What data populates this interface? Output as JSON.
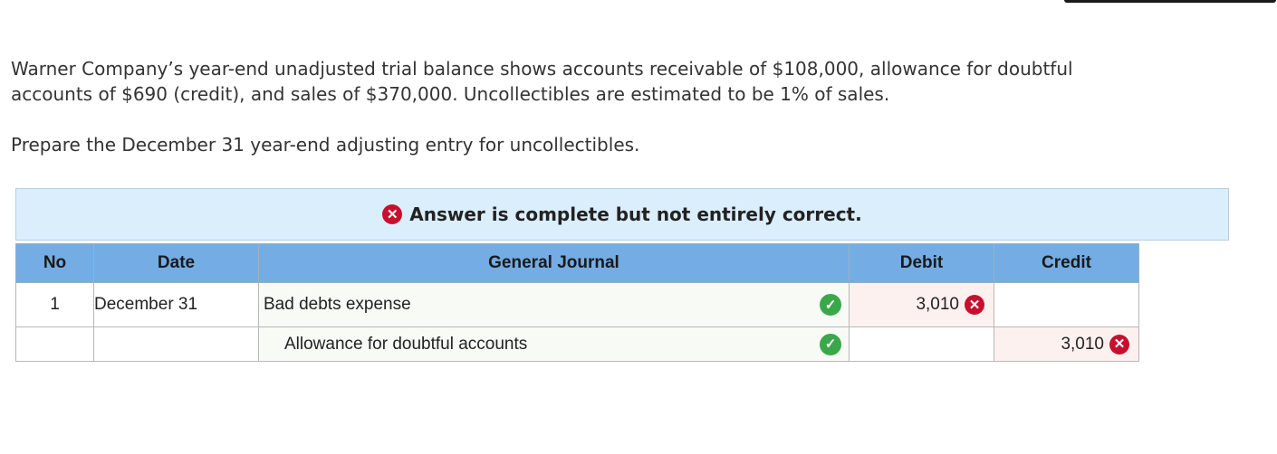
{
  "question": {
    "line1": "Warner Company’s year-end unadjusted trial balance shows accounts receivable of $108,000, allowance for doubtful",
    "line2": "accounts of $690 (credit), and sales of $370,000. Uncollectibles are estimated to be 1% of sales.",
    "prepare": "Prepare the December 31 year-end adjusting entry for uncollectibles."
  },
  "banner": {
    "text": "Answer is complete but not entirely correct.",
    "icon": "x-circle-icon"
  },
  "table": {
    "headers": {
      "no": "No",
      "date": "Date",
      "journal": "General Journal",
      "debit": "Debit",
      "credit": "Credit"
    },
    "rows": [
      {
        "no": "1",
        "date": "December 31",
        "account": "Bad debts expense",
        "account_status": "correct",
        "debit": "3,010",
        "debit_status": "incorrect",
        "credit": "",
        "credit_status": ""
      },
      {
        "no": "",
        "date": "",
        "account": "Allowance for doubtful accounts",
        "account_status": "correct",
        "debit": "",
        "debit_status": "",
        "credit": "3,010",
        "credit_status": "incorrect"
      }
    ]
  },
  "colors": {
    "header_bg": "#74ace4",
    "banner_bg": "#dbeefb",
    "incorrect_red": "#c8102e",
    "correct_green": "#3aa84a",
    "incorrect_cell_bg": "#fdf1ef"
  }
}
